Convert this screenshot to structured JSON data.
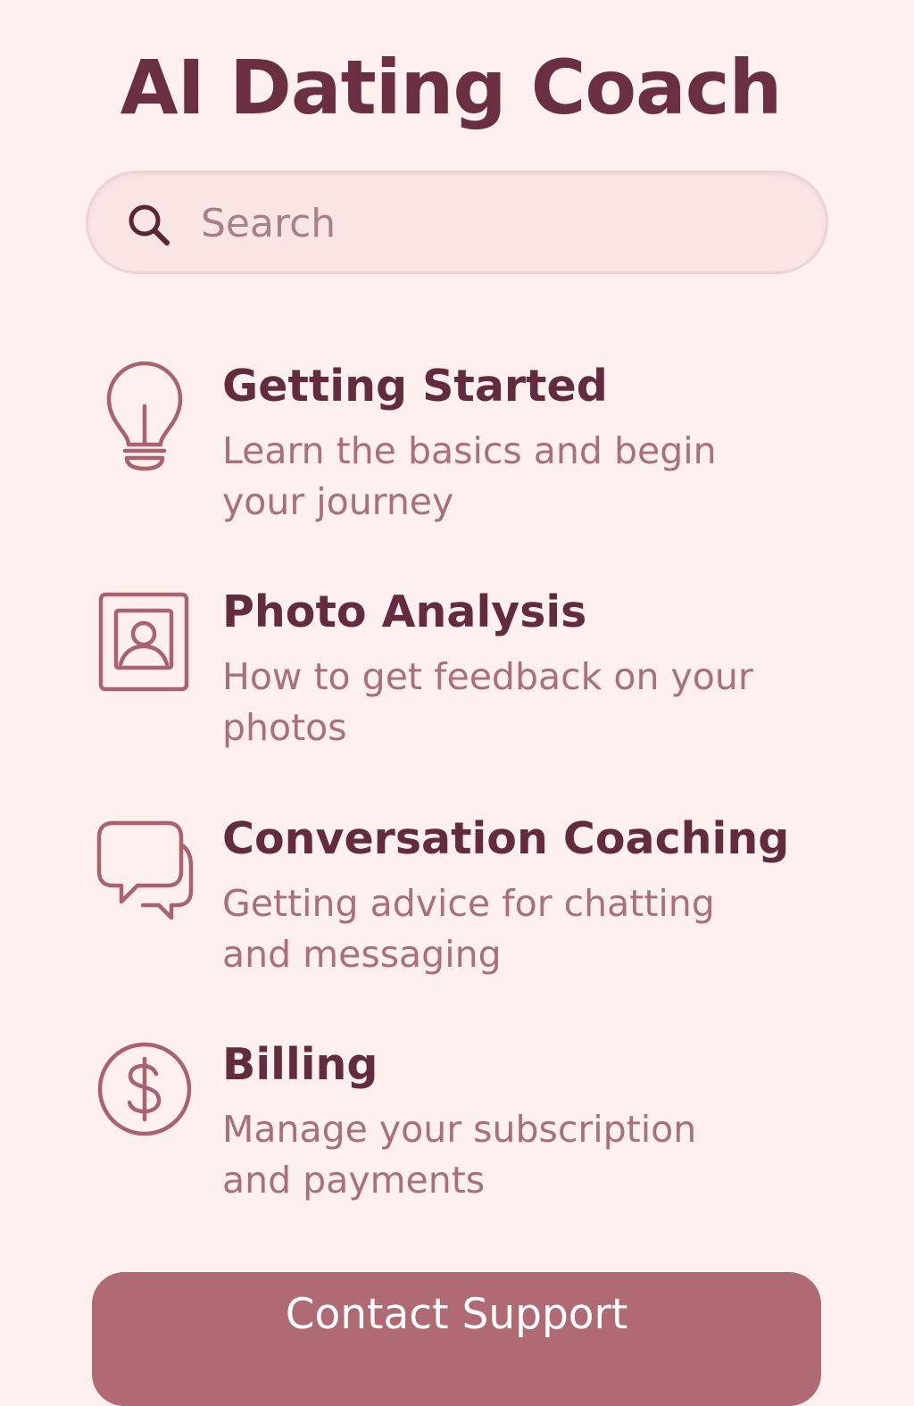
{
  "app": {
    "title": "AI Dating Coach"
  },
  "search": {
    "placeholder": "Search",
    "icon": "search-icon"
  },
  "topics": [
    {
      "icon": "lightbulb-icon",
      "title": "Getting Started",
      "description": "Learn the basics and begin your journey"
    },
    {
      "icon": "photo-portrait-icon",
      "title": "Photo Analysis",
      "description": "How to get feedback on your photos"
    },
    {
      "icon": "chat-bubbles-icon",
      "title": "Conversation Coaching",
      "description": "Getting advice for chatting and messaging"
    },
    {
      "icon": "dollar-circle-icon",
      "title": "Billing",
      "description": "Manage your subscription and payments"
    }
  ],
  "footer": {
    "contact_label": "Contact Support"
  },
  "colors": {
    "background": "#fdf0ef",
    "title": "#6a2f41",
    "topic_title": "#622c3e",
    "description": "#a9707c",
    "icon": "#a9626f",
    "button": "#b06a74",
    "search_field": "#fae5e5"
  }
}
